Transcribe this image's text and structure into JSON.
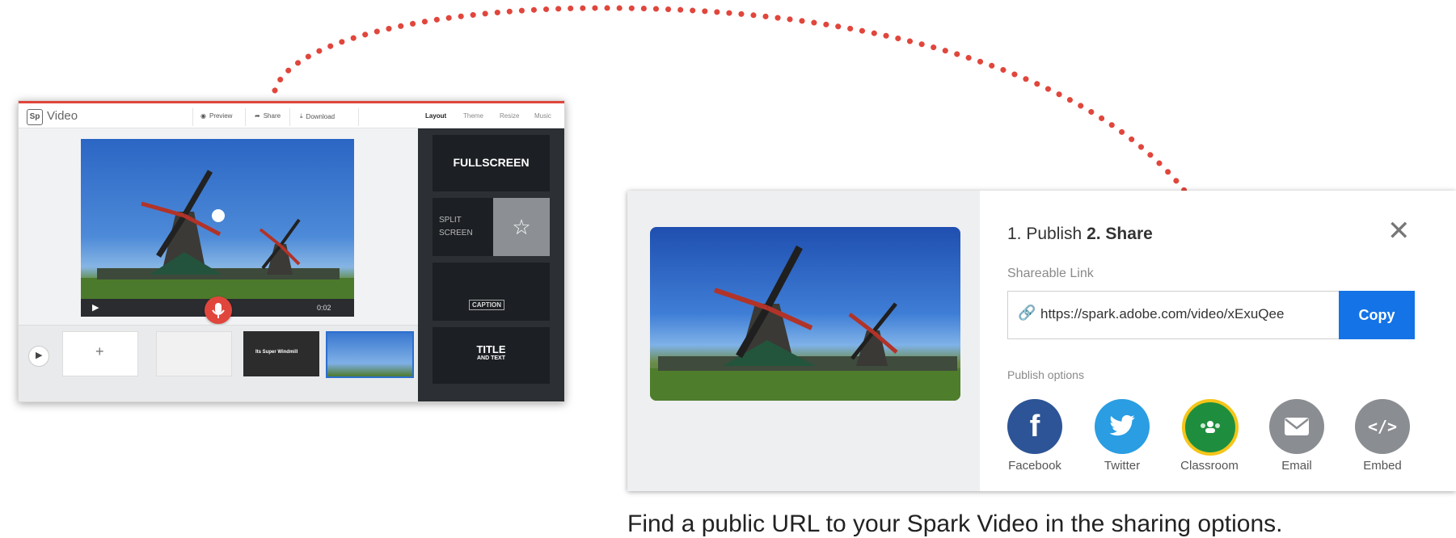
{
  "editor": {
    "app_title": "Video",
    "logo_text": "Sp",
    "toolbar": {
      "preview": "Preview",
      "share": "Share",
      "download": "Download"
    },
    "tabs": [
      "Layout",
      "Theme",
      "Resize",
      "Music"
    ],
    "active_tab": "Layout",
    "timer": "0:02",
    "slide_title": "Its Super Windmill",
    "add_slide_symbol": "+",
    "layouts": {
      "fullscreen": "FULLSCREEN",
      "split_line1": "SPLIT",
      "split_line2": "SCREEN",
      "caption": "CAPTION",
      "title_main": "TITLE",
      "title_sub": "AND TEXT"
    }
  },
  "dialog": {
    "step1": "1. Publish",
    "step2": "2. Share",
    "shareable_label": "Shareable Link",
    "link": "https://spark.adobe.com/video/xExuQee",
    "copy_label": "Copy",
    "publish_options_label": "Publish options",
    "options": [
      {
        "label": "Facebook",
        "icon": "facebook-icon",
        "color": "#2d5496"
      },
      {
        "label": "Twitter",
        "icon": "twitter-icon",
        "color": "#2a9de3"
      },
      {
        "label": "Classroom",
        "icon": "classroom-icon",
        "color": "#1e8e3e"
      },
      {
        "label": "Email",
        "icon": "email-icon",
        "color": "#8a8d91"
      },
      {
        "label": "Embed",
        "icon": "embed-icon",
        "color": "#8a8d91"
      }
    ],
    "close_symbol": "✕"
  },
  "caption": "Find a public URL to your Spark Video in the sharing options.",
  "colors": {
    "accent_red": "#e0463c",
    "copy_blue": "#1473e6"
  }
}
